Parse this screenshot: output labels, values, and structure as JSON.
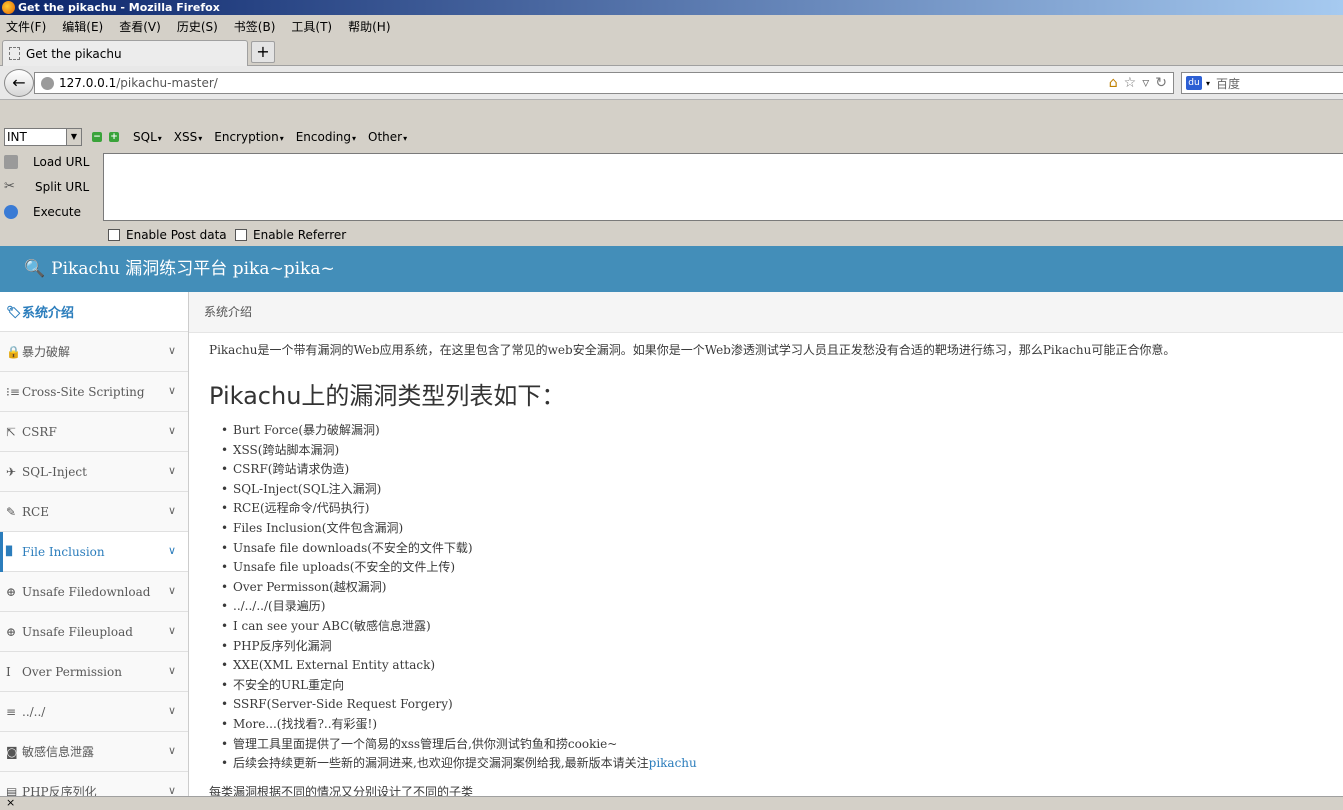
{
  "window": {
    "title": "Get the pikachu - Mozilla Firefox"
  },
  "menu": [
    "文件(F)",
    "编辑(E)",
    "查看(V)",
    "历史(S)",
    "书签(B)",
    "工具(T)",
    "帮助(H)"
  ],
  "tab": {
    "label": "Get the pikachu",
    "new_tab": "+"
  },
  "nav": {
    "url_host": "127.0.0.1",
    "url_path": "/pikachu-master/",
    "search_placeholder": "百度"
  },
  "hackbar": {
    "select_value": "INT",
    "menus": [
      "SQL",
      "XSS",
      "Encryption",
      "Encoding",
      "Other"
    ],
    "load_url": "Load URL",
    "split_url": "Split URL",
    "execute": "Execute",
    "enable_post": "Enable Post data",
    "enable_referrer": "Enable Referrer"
  },
  "site": {
    "title": "Pikachu 漏洞练习平台 pika~pika~",
    "breadcrumb": "系统介绍"
  },
  "sidebar": [
    {
      "label": "系统介绍",
      "icon": "tag-icon",
      "glyph": "🏷"
    },
    {
      "label": "暴力破解",
      "icon": "lock-icon",
      "glyph": "🔒"
    },
    {
      "label": "Cross-Site Scripting",
      "icon": "list-icon",
      "glyph": "⁝≡"
    },
    {
      "label": "CSRF",
      "icon": "share-icon",
      "glyph": "⇱"
    },
    {
      "label": "SQL-Inject",
      "icon": "plane-icon",
      "glyph": "✈"
    },
    {
      "label": "RCE",
      "icon": "pencil-icon",
      "glyph": "✎"
    },
    {
      "label": "File Inclusion",
      "icon": "file-icon",
      "glyph": "▉"
    },
    {
      "label": "Unsafe Filedownload",
      "icon": "download-icon",
      "glyph": "⊕"
    },
    {
      "label": "Unsafe Fileupload",
      "icon": "upload-icon",
      "glyph": "⊕"
    },
    {
      "label": "Over Permission",
      "icon": "text-cursor-icon",
      "glyph": "I"
    },
    {
      "label": "../../",
      "icon": "align-icon",
      "glyph": "≡"
    },
    {
      "label": "敏感信息泄露",
      "icon": "camera-icon",
      "glyph": "◙"
    },
    {
      "label": "PHP反序列化",
      "icon": "php-icon",
      "glyph": "▤"
    }
  ],
  "content": {
    "intro": "Pikachu是一个带有漏洞的Web应用系统，在这里包含了常见的web安全漏洞。如果你是一个Web渗透测试学习人员且正发愁没有合适的靶场进行练习，那么Pikachu可能正合你意。",
    "heading": "Pikachu上的漏洞类型列表如下：",
    "items": [
      "Burt Force(暴力破解漏洞)",
      "XSS(跨站脚本漏洞)",
      "CSRF(跨站请求伪造)",
      "SQL-Inject(SQL注入漏洞)",
      "RCE(远程命令/代码执行)",
      "Files Inclusion(文件包含漏洞)",
      "Unsafe file downloads(不安全的文件下载)",
      "Unsafe file uploads(不安全的文件上传)",
      "Over Permisson(越权漏洞)",
      "../../../(目录遍历)",
      "I can see your ABC(敏感信息泄露)",
      "PHP反序列化漏洞",
      "XXE(XML External Entity attack)",
      "不安全的URL重定向",
      "SSRF(Server-Side Request Forgery)",
      "More...(找找看?..有彩蛋!)",
      "管理工具里面提供了一个简易的xss管理后台,供你测试钓鱼和捞cookie~"
    ],
    "last_item_text": "后续会持续更新一些新的漏洞进来,也欢迎你提交漏洞案例给我,最新版本请关注",
    "last_item_link": "pikachu",
    "footer": "每类漏洞根据不同的情况又分别设计了不同的子类"
  },
  "status": {
    "close": "×"
  },
  "colors": {
    "header_bg": "#438eb9",
    "link": "#2b7dbc"
  }
}
